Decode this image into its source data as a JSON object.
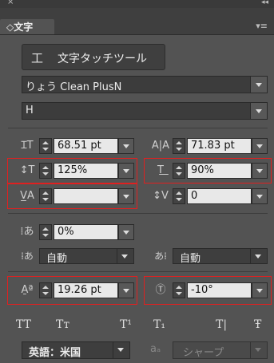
{
  "titlebar": {
    "close_icon": "×",
    "collapse_icon": "◂◂"
  },
  "tab": {
    "label": "◇文字"
  },
  "panel_menu_icon": "▾≡",
  "touch_tool": {
    "icon": "工",
    "label": "文字タッチツール"
  },
  "font_family": {
    "value": "りょう Clean PlusN"
  },
  "font_style": {
    "value": "H"
  },
  "char": {
    "font_size": "68.51 pt",
    "leading": "71.83 pt",
    "vertical_scale": "125%",
    "horizontal_scale": "90%",
    "kerning": "",
    "tracking": "0",
    "tsume": "0%",
    "aki_left": "自動",
    "aki_right": "自動",
    "baseline_shift": "19.26 pt",
    "rotation": "-10°"
  },
  "style_buttons": [
    "TT",
    "Tт",
    "T¹",
    "T₁",
    "T|",
    "Ŧ"
  ],
  "language": {
    "value": "英語：米国"
  },
  "antialias": {
    "icon": "aₐ",
    "value": "シャープ"
  },
  "colors": {
    "highlight": "#e02020",
    "panel_bg": "#535353"
  }
}
